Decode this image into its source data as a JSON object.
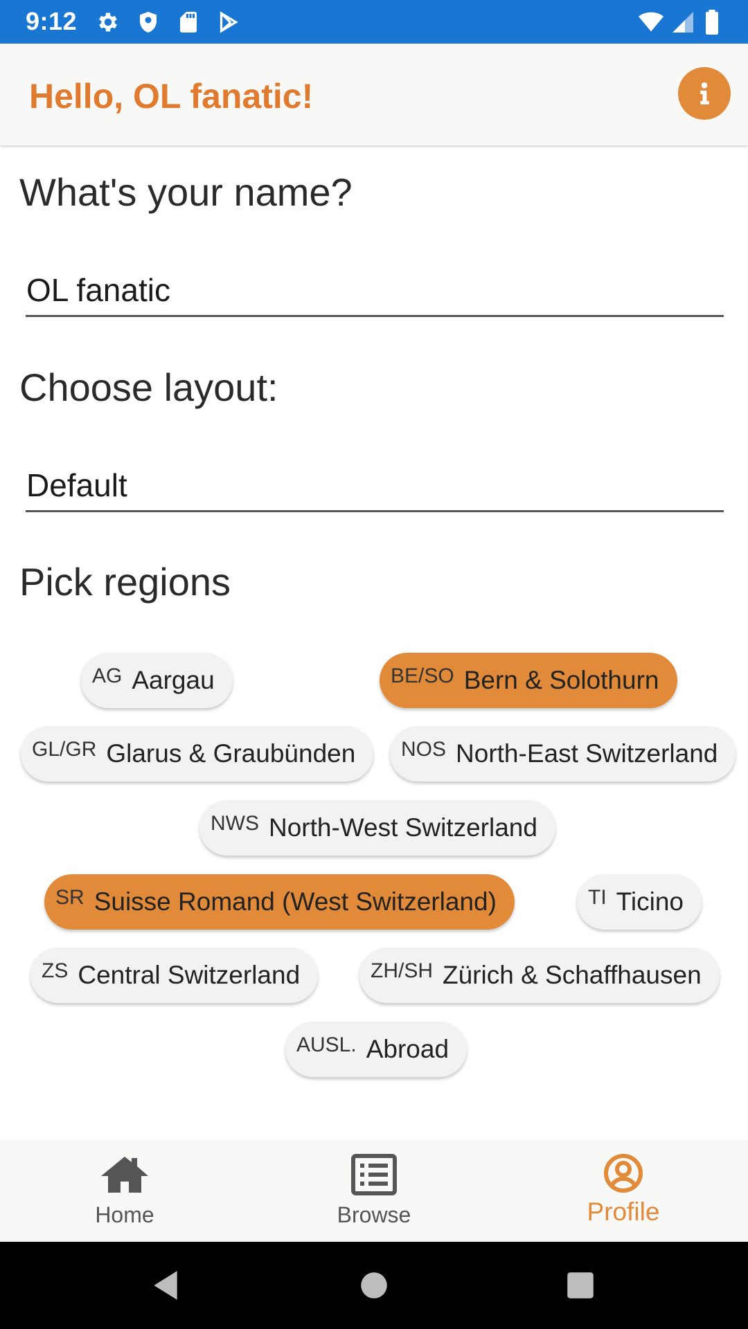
{
  "status_bar": {
    "time": "9:12",
    "background_color": "#1976d2",
    "left_icons": [
      "gear-icon",
      "shield-icon",
      "sd-card-icon",
      "play-store-icon"
    ],
    "right_icons": [
      "wifi-icon",
      "cell-signal-icon",
      "battery-icon"
    ]
  },
  "app_bar": {
    "title": "Hello, OL fanatic!",
    "title_color": "#e07a2e",
    "info_icon": "info-icon"
  },
  "form": {
    "name_heading": "What's your name?",
    "name_value": "OL fanatic",
    "layout_heading": "Choose layout:",
    "layout_value": "Default",
    "regions_heading": "Pick regions"
  },
  "regions": [
    {
      "code": "AG",
      "name": "Aargau",
      "selected": false
    },
    {
      "code": "BE/SO",
      "name": "Bern & Solothurn",
      "selected": true
    },
    {
      "code": "GL/GR",
      "name": "Glarus & Graubünden",
      "selected": false
    },
    {
      "code": "NOS",
      "name": "North-East Switzerland",
      "selected": false
    },
    {
      "code": "NWS",
      "name": "North-West Switzerland",
      "selected": false
    },
    {
      "code": "SR",
      "name": "Suisse Romand (West Switzerland)",
      "selected": true
    },
    {
      "code": "TI",
      "name": "Ticino",
      "selected": false
    },
    {
      "code": "ZS",
      "name": "Central Switzerland",
      "selected": false
    },
    {
      "code": "ZH/SH",
      "name": "Zürich & Schaffhausen",
      "selected": false
    },
    {
      "code": "AUSL.",
      "name": "Abroad",
      "selected": false
    }
  ],
  "accent_color": "#e08a3a",
  "bottom_nav": {
    "items": [
      {
        "label": "Home",
        "icon": "home-icon",
        "active": false
      },
      {
        "label": "Browse",
        "icon": "list-icon",
        "active": false
      },
      {
        "label": "Profile",
        "icon": "profile-icon",
        "active": true
      }
    ]
  },
  "system_nav": {
    "buttons": [
      "back-icon",
      "home-circle-icon",
      "recents-icon"
    ]
  }
}
